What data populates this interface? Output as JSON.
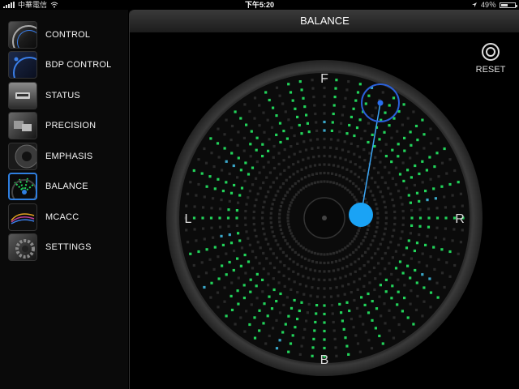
{
  "status_bar": {
    "carrier": "中華電信",
    "time": "下午5:20",
    "battery": "49％",
    "battery_level": 0.49,
    "icons": [
      "signal-icon",
      "wifi-icon",
      "location-arrow-icon",
      "battery-icon"
    ]
  },
  "sidebar": {
    "items": [
      {
        "label": "CONTROL",
        "icon": "control-dial-icon",
        "active": false
      },
      {
        "label": "BDP CONTROL",
        "icon": "bdp-control-icon",
        "active": false
      },
      {
        "label": "STATUS",
        "icon": "status-icon",
        "active": false
      },
      {
        "label": "PRECISION",
        "icon": "precision-icon",
        "active": false
      },
      {
        "label": "EMPHASIS",
        "icon": "emphasis-speaker-icon",
        "active": false
      },
      {
        "label": "BALANCE",
        "icon": "balance-icon",
        "active": true
      },
      {
        "label": "MCACC",
        "icon": "mcacc-icon",
        "active": false
      },
      {
        "label": "SETTINGS",
        "icon": "settings-gear-icon",
        "active": false
      }
    ]
  },
  "main": {
    "title": "BALANCE",
    "reset_label": "RESET",
    "dial": {
      "front_label": "F",
      "back_label": "B",
      "left_label": "L",
      "right_label": "R"
    }
  },
  "colors": {
    "accent": "#2f7fe0",
    "dot_green": "#22d35a",
    "dot_cyan": "#3aa6c8",
    "dot_dim": "#2a2a2a",
    "knob": "#1aa3f5"
  }
}
